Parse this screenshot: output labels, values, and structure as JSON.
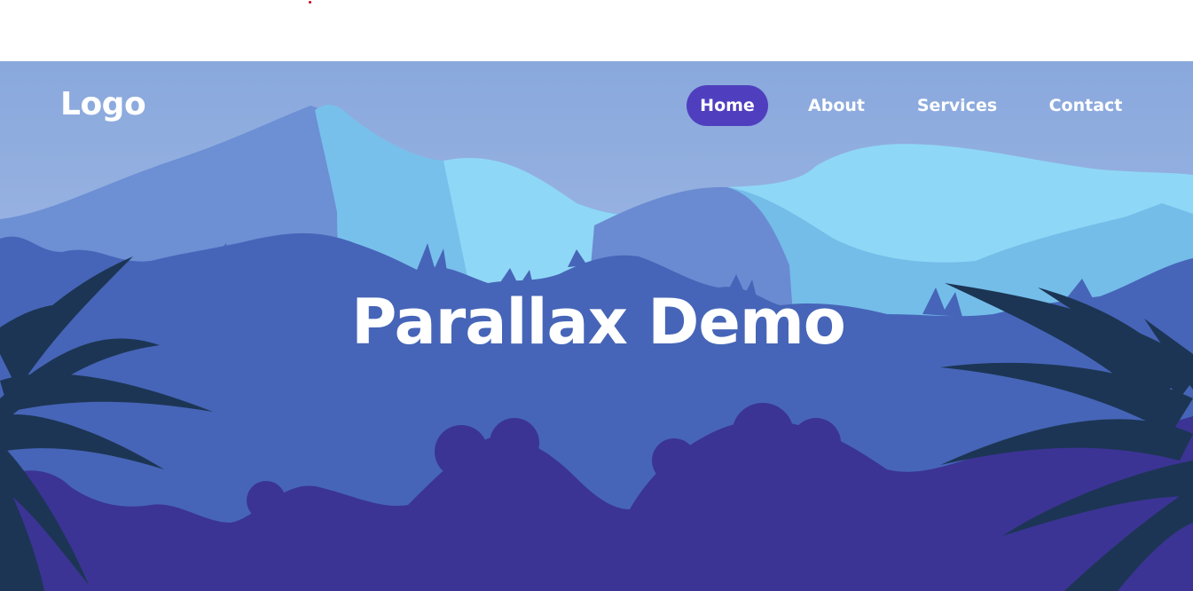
{
  "header": {
    "logo": "Logo"
  },
  "nav": {
    "items": [
      {
        "label": "Home",
        "active": true
      },
      {
        "label": "About",
        "active": false
      },
      {
        "label": "Services",
        "active": false
      },
      {
        "label": "Contact",
        "active": false
      }
    ]
  },
  "hero": {
    "title": "Parallax Demo"
  },
  "colors": {
    "sky_top": "#8ca9de",
    "sky_bottom": "#aebfeb",
    "mountain_back": "#6d8fd4",
    "mountain_light": "#79c0ec",
    "mountain_lightest": "#8fd7f6",
    "forest_mid": "#4665b8",
    "forest_front": "#3b3494",
    "leaves": "#1c3554",
    "nav_active": "#4f3fbf",
    "text": "#ffffff"
  }
}
